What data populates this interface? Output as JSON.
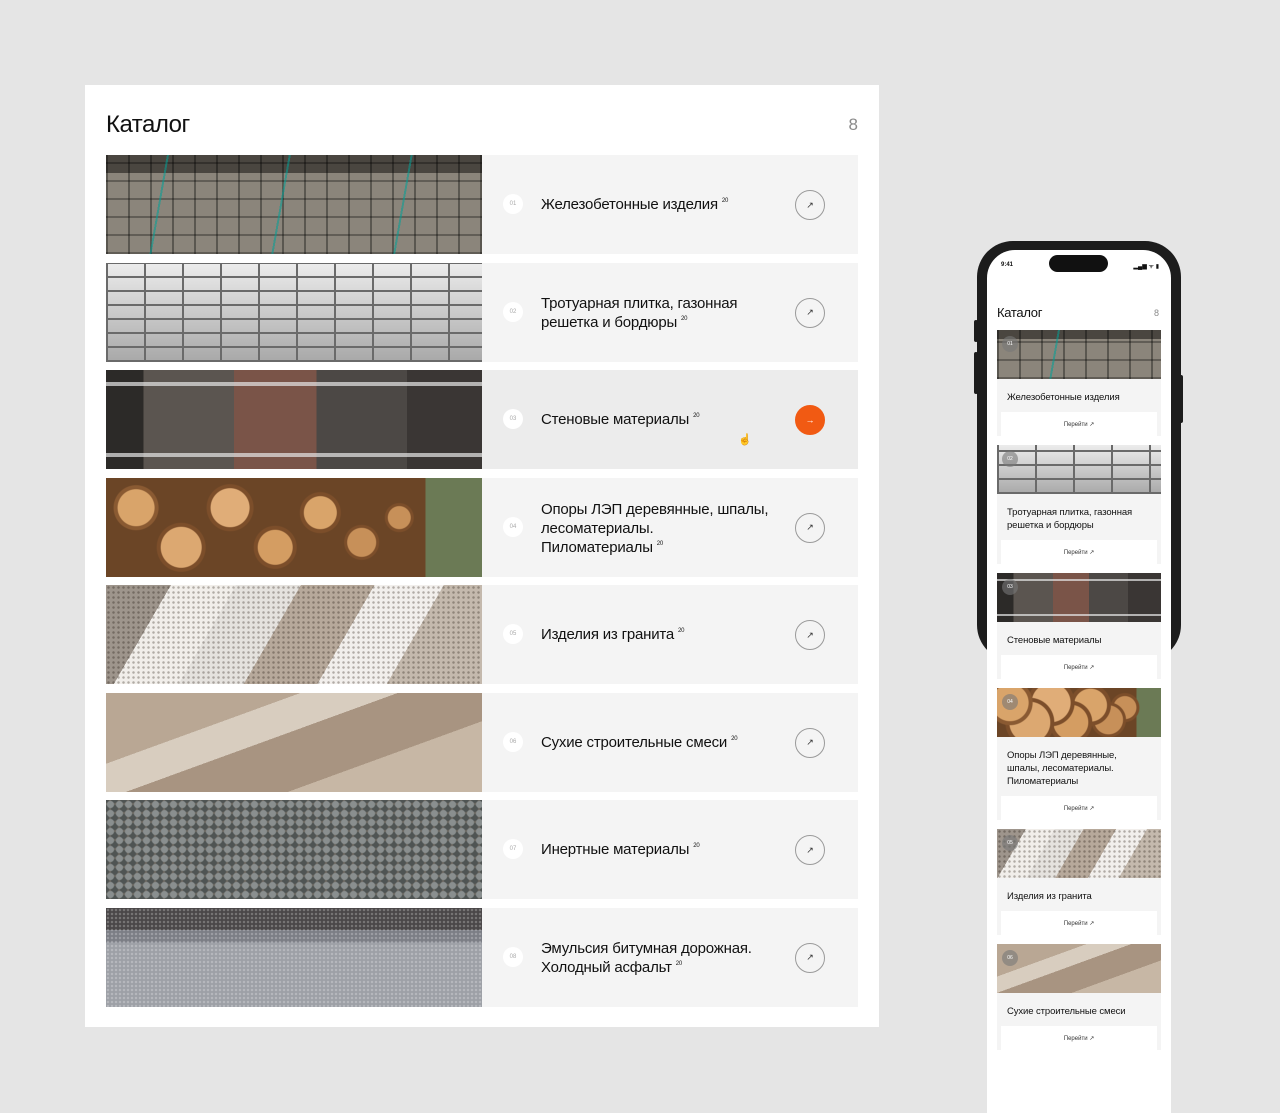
{
  "desktop": {
    "title": "Каталог",
    "count": "8",
    "items": [
      {
        "num": "01",
        "name": "Железобетонные изделия",
        "badge": "20",
        "arrow": "↗",
        "image": "concrete-blocks"
      },
      {
        "num": "02",
        "name": "Тротуарная плитка, газонная решетка и бордюры",
        "badge": "20",
        "arrow": "↗",
        "image": "paving-tiles"
      },
      {
        "num": "03",
        "name": "Стеновые материалы",
        "badge": "20",
        "arrow": "→",
        "image": "bricks"
      },
      {
        "num": "04",
        "name": "Опоры ЛЭП деревянные, шпалы, лесоматериалы. Пиломатериалы",
        "badge": "20",
        "arrow": "↗",
        "image": "logs"
      },
      {
        "num": "05",
        "name": "Изделия из гранита",
        "badge": "20",
        "arrow": "↗",
        "image": "granite"
      },
      {
        "num": "06",
        "name": "Сухие строительные смеси",
        "badge": "20",
        "arrow": "↗",
        "image": "dry-mix"
      },
      {
        "num": "07",
        "name": "Инертные материалы",
        "badge": "20",
        "arrow": "↗",
        "image": "gravel"
      },
      {
        "num": "08",
        "name": "Эмульсия битумная дорожная. Холодный асфальт",
        "badge": "20",
        "arrow": "↗",
        "image": "asphalt"
      }
    ],
    "accent_color": "#f15a13"
  },
  "phone": {
    "status_time": "9:41",
    "status_icons": "▂▄▆ ᯤ ▮",
    "title": "Каталог",
    "count": "8",
    "button_label": "Перейти ↗",
    "items": [
      {
        "num": "01",
        "name": "Железобетонные изделия"
      },
      {
        "num": "02",
        "name": "Тротуарная плитка, газонная решетка и бордюры"
      },
      {
        "num": "03",
        "name": "Стеновые материалы"
      },
      {
        "num": "04",
        "name": "Опоры ЛЭП деревянные, шпалы, лесоматериалы. Пиломатериалы"
      },
      {
        "num": "05",
        "name": "Изделия из гранита"
      },
      {
        "num": "06",
        "name": "Сухие строительные смеси"
      }
    ]
  }
}
